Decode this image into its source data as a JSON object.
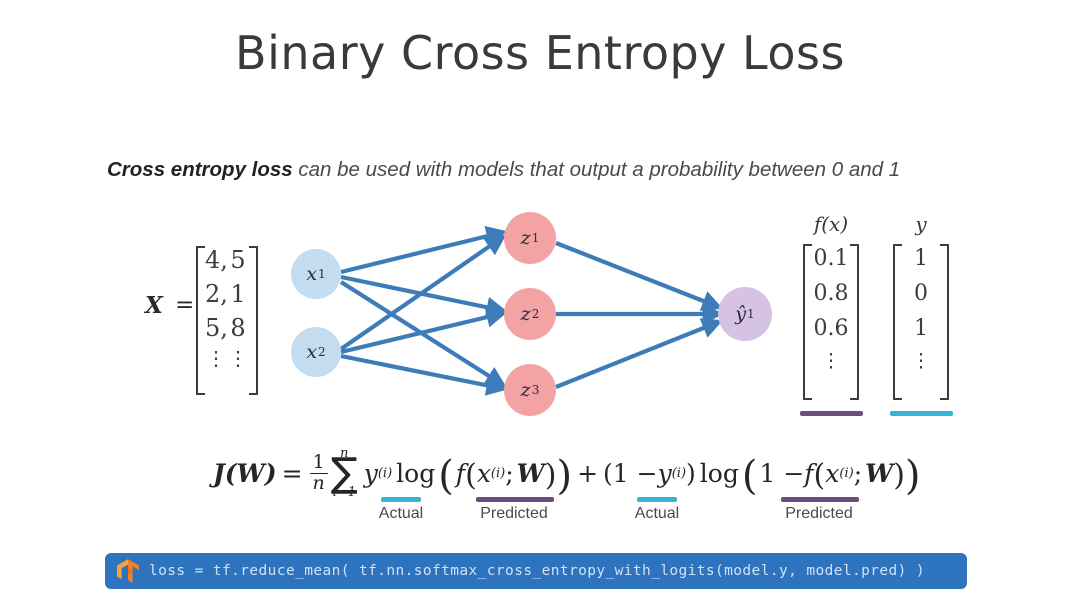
{
  "slide": {
    "title": "Binary Cross Entropy Loss",
    "subtitle_lead": "Cross entropy loss",
    "subtitle_rest": " can be used with models that output a probability between 0 and 1"
  },
  "network": {
    "input_matrix": {
      "label": "X",
      "equals": "=",
      "rows": [
        {
          "c1": "4,",
          "c2": "5"
        },
        {
          "c1": "2,",
          "c2": "1"
        },
        {
          "c1": "5,",
          "c2": "8"
        },
        {
          "c1": "⋮",
          "c2": "⋮"
        }
      ]
    },
    "input_nodes": [
      {
        "base": "x",
        "sub": "1"
      },
      {
        "base": "x",
        "sub": "2"
      }
    ],
    "hidden_nodes": [
      {
        "base": "z",
        "sub": "1"
      },
      {
        "base": "z",
        "sub": "2"
      },
      {
        "base": "z",
        "sub": "3"
      }
    ],
    "output_node": {
      "base": "ŷ",
      "sub": "1"
    },
    "colors": {
      "input_node": "#c3dcef",
      "hidden_node": "#f3a3a3",
      "output_node": "#d6c2e2",
      "edge": "#3d7cb8",
      "predicted_underline": "#6b4d7e",
      "actual_underline": "#35b4d4",
      "code_bar": "#2e73bd",
      "code_text": "#cfe2f5",
      "tf_logo": "#f58220"
    }
  },
  "vectors": {
    "predicted": {
      "label": "f(x)",
      "values": [
        "0.1",
        "0.8",
        "0.6",
        "⋮"
      ],
      "underline_color": "#6b4d7e"
    },
    "actual": {
      "label": "y",
      "values": [
        "1",
        "0",
        "1",
        "⋮"
      ],
      "underline_color": "#35b4d4"
    }
  },
  "formula": {
    "lhs": "J(W)",
    "equals": "=",
    "fraction_num": "1",
    "fraction_den": "n",
    "sigma_top": "n",
    "sigma_bot": "i=1",
    "term1_y": "y",
    "term1_y_sup": "(i)",
    "log1": "log",
    "term1_f": "f",
    "term1_x": "x",
    "term1_x_sup": "(i)",
    "term1_semicolon": ";",
    "term1_W": "W",
    "plus": "+",
    "term2_one_minus": "(1 − ",
    "term2_y": "y",
    "term2_y_sup": "(i)",
    "term2_close": ")",
    "log2": "log",
    "term2_inner_one_minus": "1 − ",
    "term2_f": "f",
    "term2_x": "x",
    "term2_x_sup": "(i)",
    "term2_semicolon": ";",
    "term2_W": "W"
  },
  "legend": [
    {
      "text": "Actual",
      "color": "#35b4d4"
    },
    {
      "text": "Predicted",
      "color": "#6b4d7e"
    },
    {
      "text": "Actual",
      "color": "#35b4d4"
    },
    {
      "text": "Predicted",
      "color": "#6b4d7e"
    }
  ],
  "code": {
    "logo": "tensorflow-logo",
    "text": "loss = tf.reduce_mean( tf.nn.softmax_cross_entropy_with_logits(model.y, model.pred) )"
  }
}
